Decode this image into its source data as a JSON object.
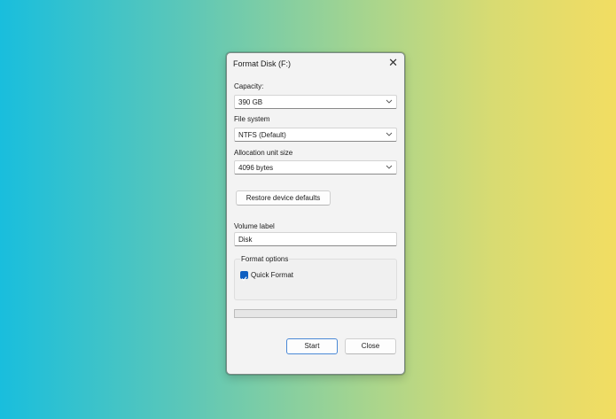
{
  "window": {
    "title": "Format Disk (F:)"
  },
  "capacity": {
    "label": "Capacity:",
    "value": "390 GB"
  },
  "file_system": {
    "label": "File system",
    "value": "NTFS (Default)"
  },
  "allocation": {
    "label": "Allocation unit size",
    "value": "4096 bytes"
  },
  "restore_button": "Restore device defaults",
  "volume": {
    "label": "Volume label",
    "value": "Disk"
  },
  "format_options": {
    "title": "Format options",
    "quick_format": {
      "label": "Quick Format",
      "checked": true
    }
  },
  "progress": {
    "fraction": 0
  },
  "buttons": {
    "start": "Start",
    "close": "Close"
  },
  "colors": {
    "accent": "#0f5fc1"
  },
  "icons": {
    "close": "close-icon",
    "dropdown": "chevron-down-icon",
    "check": "checkmark-icon"
  }
}
